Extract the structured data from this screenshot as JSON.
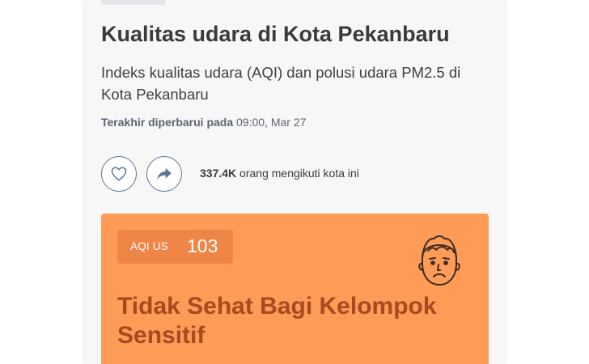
{
  "header": {
    "title": "Kualitas udara di Kota Pekanbaru",
    "subtitle": "Indeks kualitas udara (AQI) dan polusi udara PM2.5 di Kota Pekanbaru",
    "updated_label": "Terakhir diperbarui pada",
    "updated_value": "09:00, Mar 27"
  },
  "actions": {
    "like_icon": "heart-icon",
    "share_icon": "share-arrow-icon",
    "follower_count": "337.4K",
    "follower_text": "orang mengikuti kota ini"
  },
  "aqi": {
    "badge_label": "AQI US",
    "value": "103",
    "status": "Tidak Sehat Bagi Kelompok Sensitif",
    "face_icon": "sad-face-icon",
    "card_color": "#fe9b57",
    "badge_color": "#ef8547",
    "status_color": "#a84a1f"
  }
}
